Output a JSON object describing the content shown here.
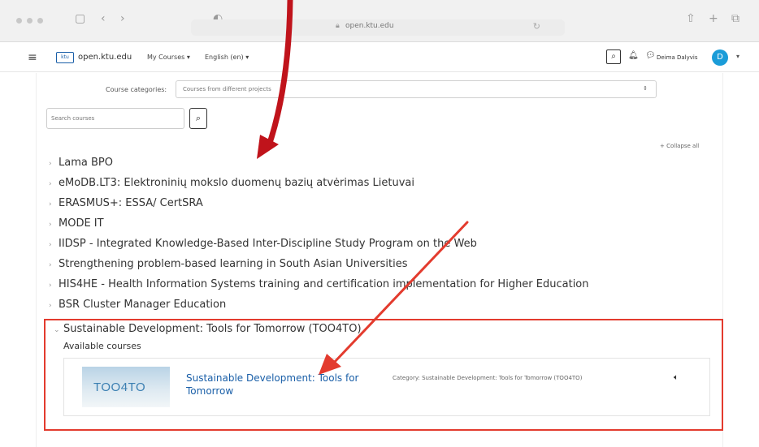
{
  "browser": {
    "url": "open.ktu.edu"
  },
  "navbar": {
    "logo_text": "ktu",
    "site_name": "open.ktu.edu",
    "menu": [
      "My Courses ▾",
      "English (en) ▾"
    ],
    "user_name": "Deima Dalyvis",
    "avatar_letter": "D"
  },
  "filters": {
    "category_label": "Course categories:",
    "category_value": "Courses from different projects",
    "search_placeholder": "Search courses"
  },
  "collapse_all": "+ Collapse all",
  "categories": [
    "Lama BPO",
    "eMoDB.LT3: Elektroninių mokslo duomenų bazių atvėrimas Lietuvai",
    "ERASMUS+: ESSA/ CertSRA",
    "MODE IT",
    "IIDSP - Integrated Knowledge-Based Inter-Discipline Study Program on the Web",
    "Strengthening problem-based learning in South Asian Universities",
    "HIS4HE - Health Information Systems training and certification implementation for Higher Education",
    "BSR Cluster Manager Education"
  ],
  "expanded_category": {
    "name": "Sustainable Development: Tools for Tomorrow (TOO4TO)",
    "available_label": "Available courses",
    "course": {
      "thumb_text": "TOO4TO",
      "title": "Sustainable Development: Tools for Tomorrow",
      "category_label": "Category:",
      "category_value": "Sustainable Development: Tools for Tomorrow (TOO4TO)"
    }
  },
  "colors": {
    "annotation_dark_red": "#c0131b",
    "annotation_red": "#e33b2e",
    "link_blue": "#1a5fa8",
    "avatar_blue": "#1a9cd8"
  }
}
